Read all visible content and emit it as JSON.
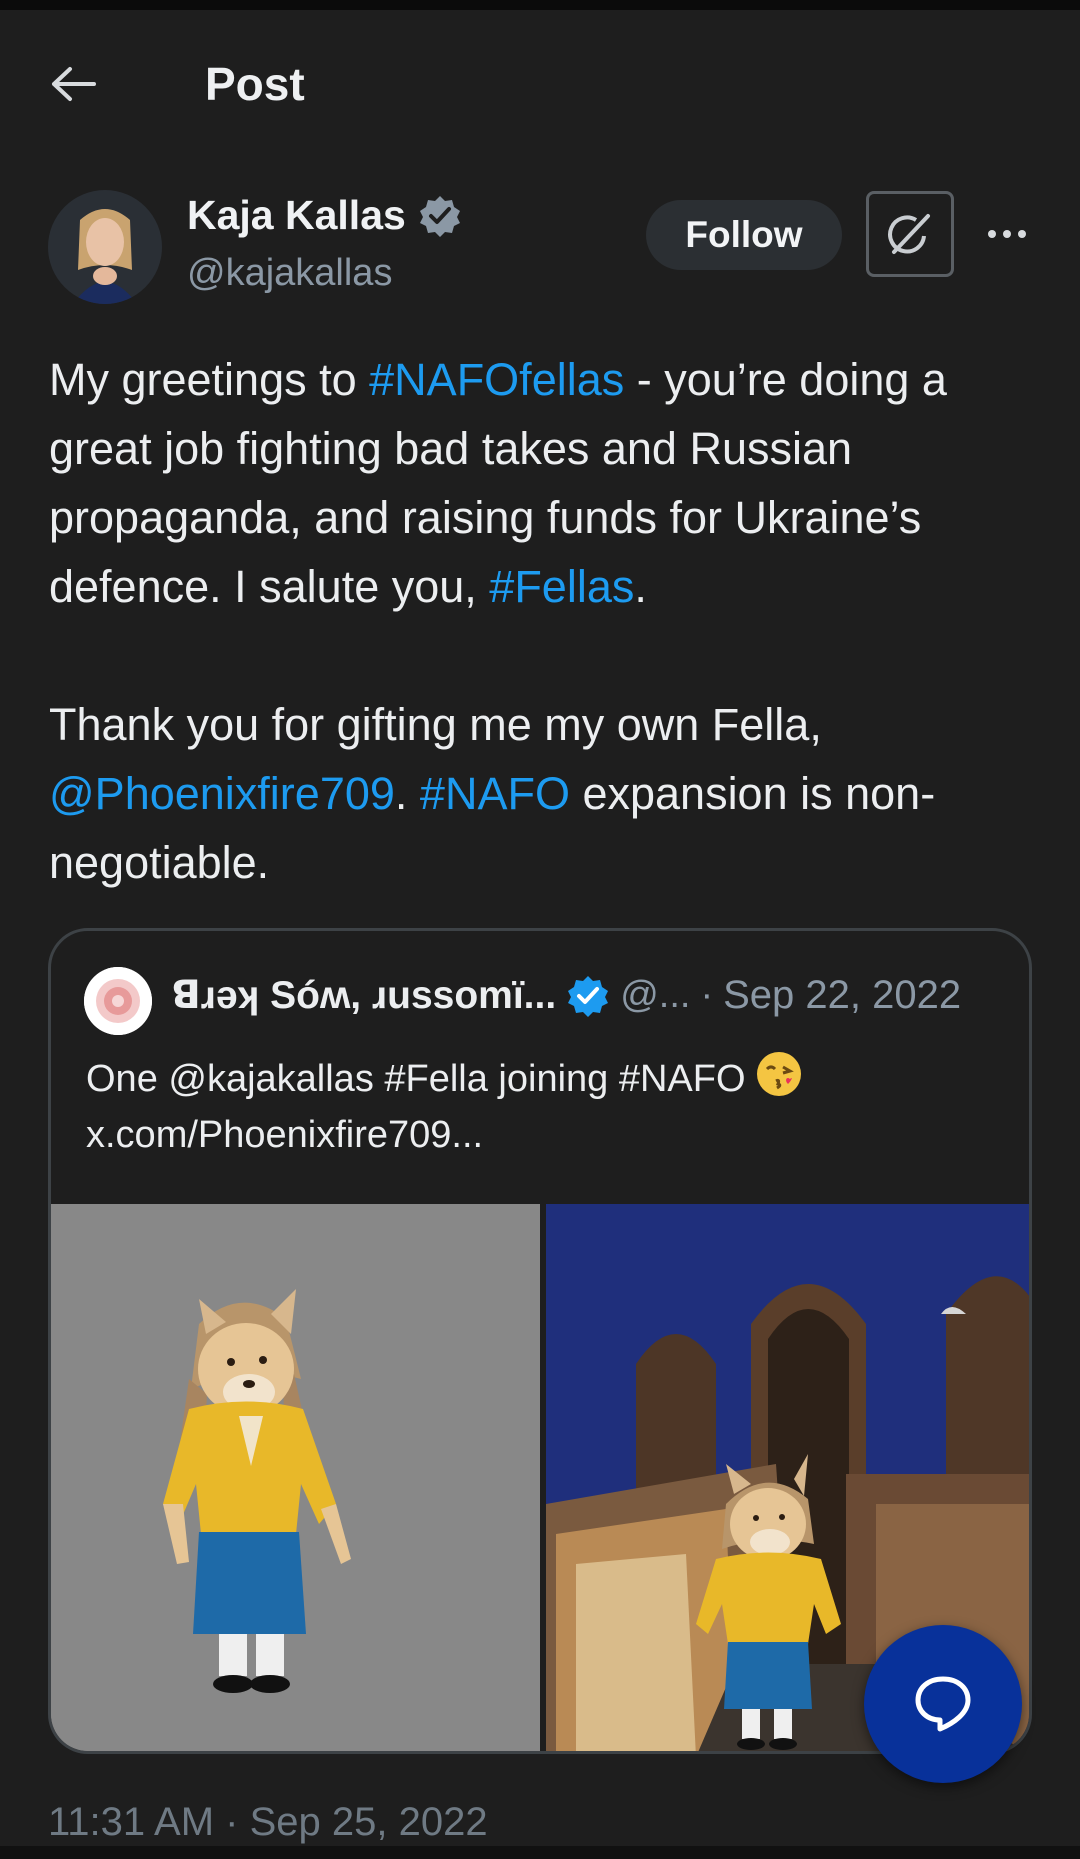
{
  "header": {
    "title": "Post",
    "back_icon": "arrow-left-icon"
  },
  "author": {
    "name": "Kaja Kallas",
    "handle": "@kajakallas",
    "verified_color": "#8b98a5",
    "follow_label": "Follow"
  },
  "tweet": {
    "paragraph1": [
      {
        "text": "My greetings to ",
        "link": false
      },
      {
        "text": "#NAFOfellas",
        "link": true
      },
      {
        "text": " - you’re doing a great job fighting bad takes and Russian propaganda, and raising funds for Ukraine’s defence. I salute you, ",
        "link": false
      },
      {
        "text": "#Fellas",
        "link": true
      },
      {
        "text": ".",
        "link": false
      }
    ],
    "paragraph2": [
      {
        "text": "Thank you for gifting me my own Fella, ",
        "link": false
      },
      {
        "text": "@Phoenixfire709",
        "link": true
      },
      {
        "text": ". ",
        "link": false
      },
      {
        "text": "#NAFO",
        "link": true
      },
      {
        "text": " expansion is non-negotiable.",
        "link": false
      }
    ]
  },
  "quote": {
    "name": "ꓭɹǝʞ Sóʍ, ɹussomï...",
    "handle": "@...",
    "separator": "·",
    "date": "Sep 22, 2022",
    "verified_color": "#1d9bf0",
    "line1": "One @kajakallas #Fella joining #NAFO",
    "emoji": "kissing-face-emoji",
    "line2": "x.com/Phoenixfire709..."
  },
  "timestamp": "11:31 AM · Sep 25, 2022",
  "colors": {
    "background": "#1e1e1e",
    "link": "#1d9bf0",
    "fab": "#08319a"
  }
}
